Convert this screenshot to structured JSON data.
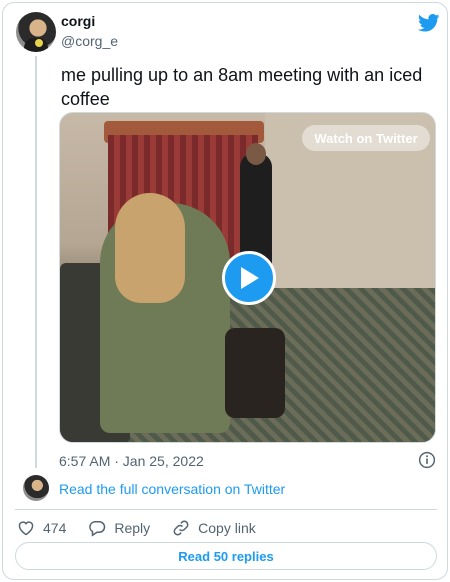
{
  "tweet": {
    "author": {
      "display_name": "corgi",
      "handle": "@corg_e"
    },
    "text": "me pulling up to an 8am meeting with an iced coffee",
    "timestamp": "6:57 AM · Jan 25, 2022"
  },
  "media": {
    "watch_label": "Watch on Twitter"
  },
  "conversation": {
    "read_full_label": "Read the full conversation on Twitter"
  },
  "actions": {
    "like_count": "474",
    "reply_label": "Reply",
    "copy_link_label": "Copy link"
  },
  "footer": {
    "read_replies_label": "Read 50 replies"
  },
  "colors": {
    "accent": "#1d9bf0",
    "text": "#0f1419",
    "muted": "#536471",
    "border": "#cfd9de"
  }
}
